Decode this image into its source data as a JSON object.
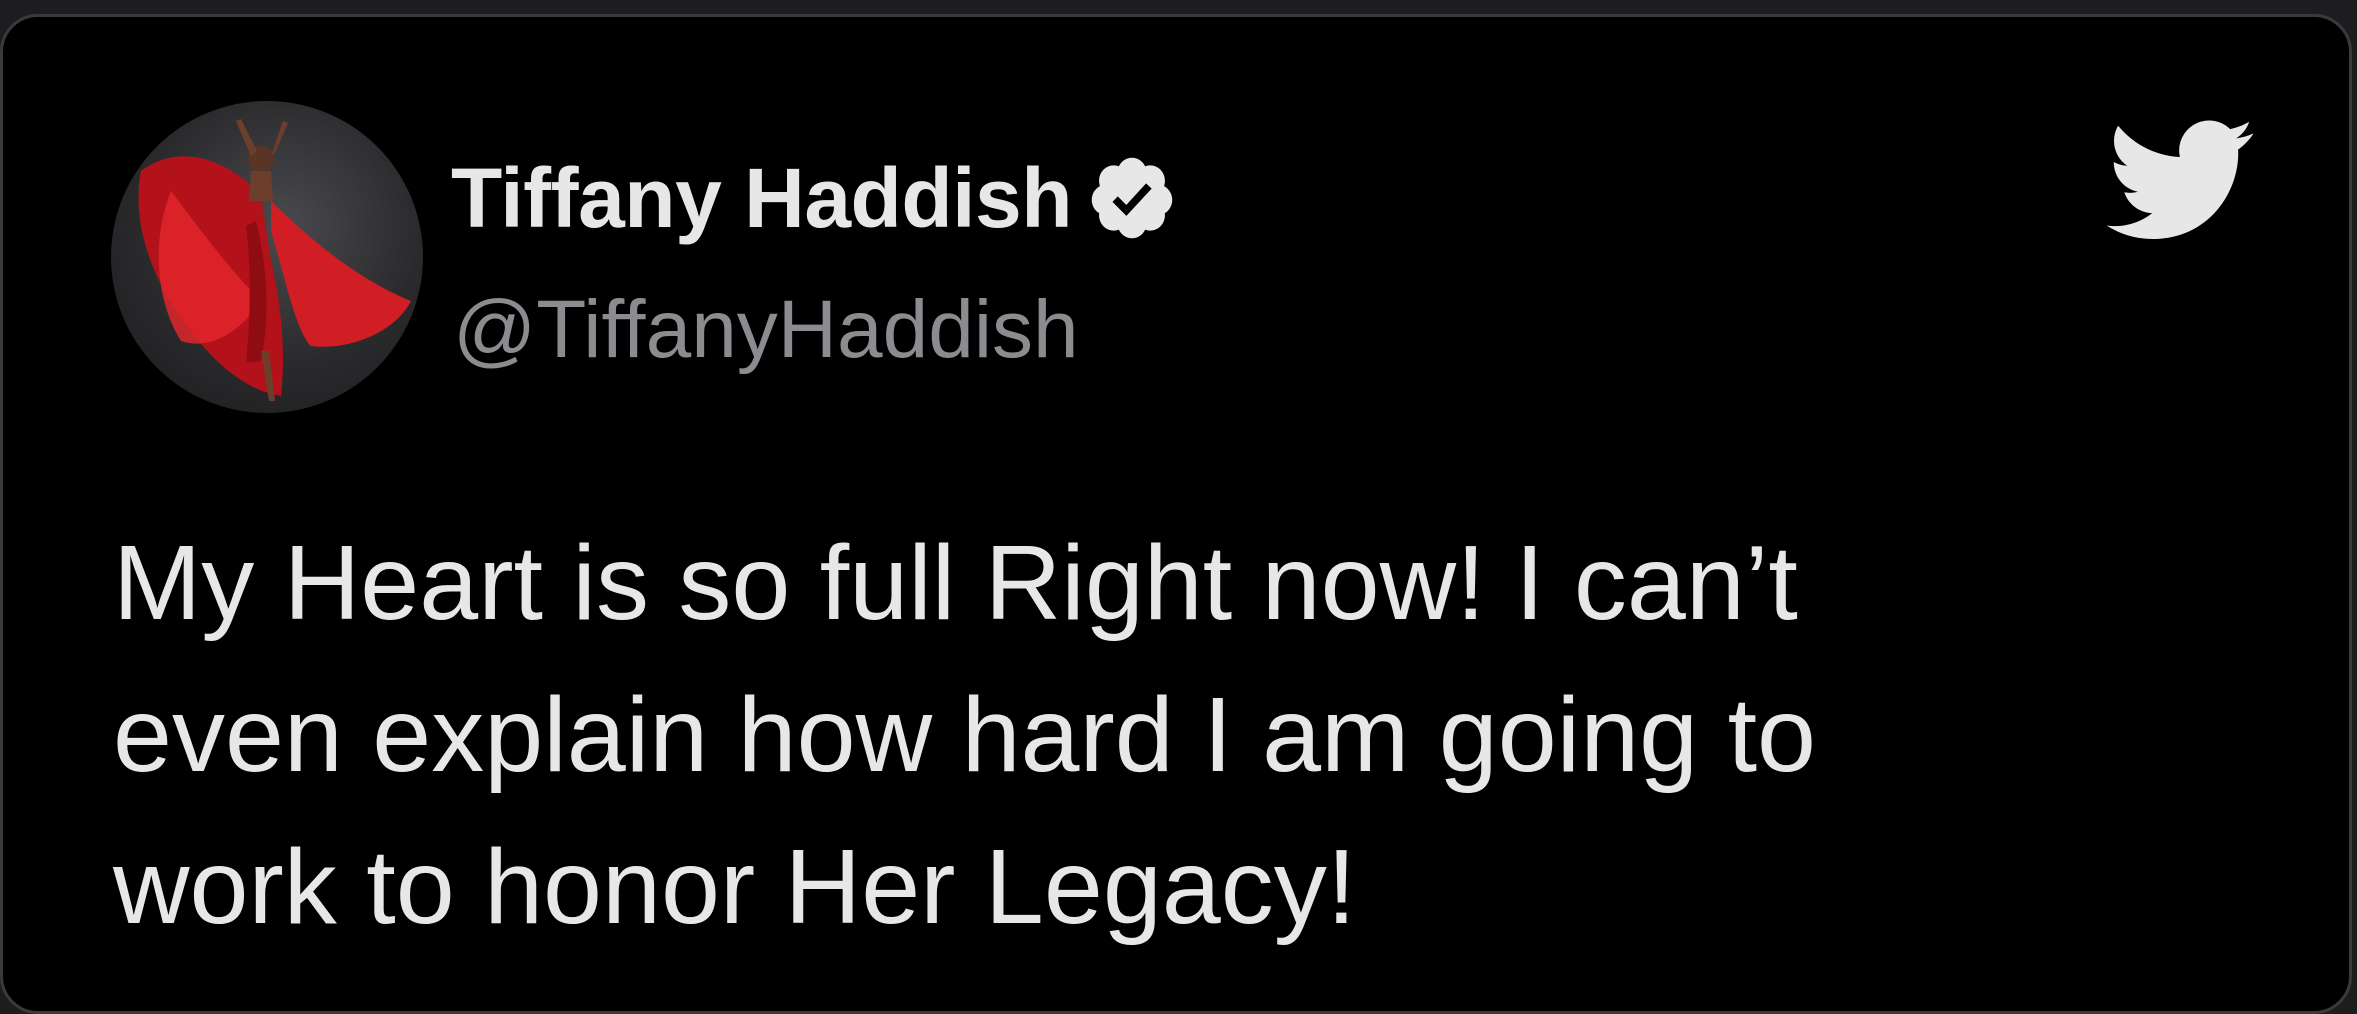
{
  "tweet": {
    "author": {
      "display_name": "Tiffany Haddish",
      "handle": "@TiffanyHaddish",
      "verified": true,
      "verified_icon": "verified-badge-icon",
      "avatar": "profile-photo-red-dress"
    },
    "platform_icon": "twitter-bird-icon",
    "text_lines": [
      "My Heart is so full Right now! I can’t",
      "even explain how hard I am going to",
      "work to honor Her Legacy!"
    ]
  },
  "colors": {
    "background": "#000000",
    "card_border": "#3a3a3c",
    "text_primary": "#e7e7e7",
    "text_secondary": "#8b8b90",
    "avatar_accent": "#c4161c"
  }
}
